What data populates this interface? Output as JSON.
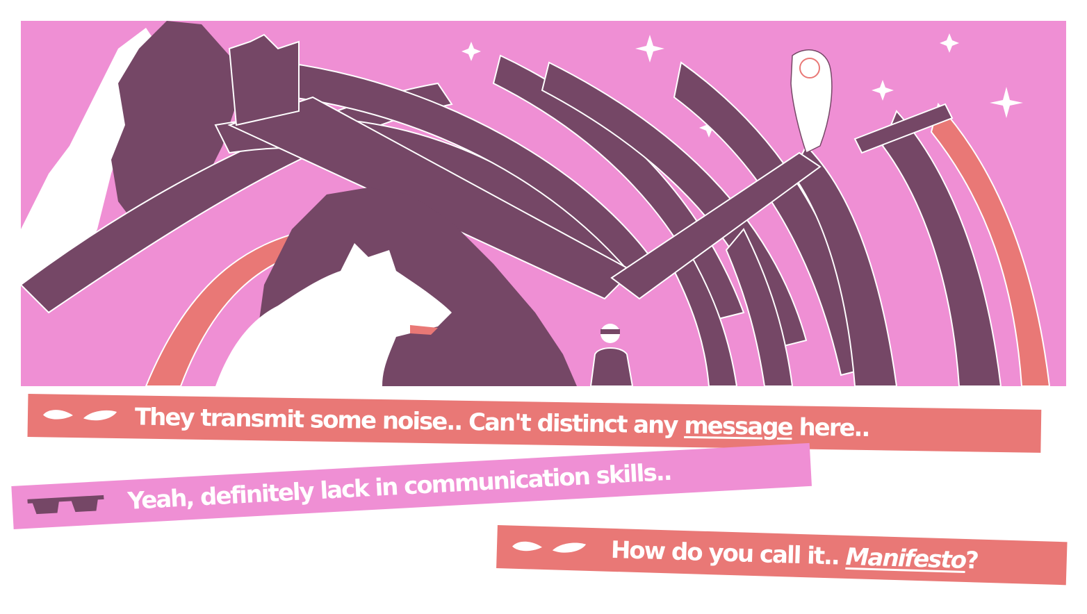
{
  "colors": {
    "sky": "#ef8fd4",
    "plum": "#754766",
    "coral": "#e97876",
    "white": "#ffffff"
  },
  "dialogue": [
    {
      "speaker_icon": "wolf-eyes-icon",
      "color": "#e97876",
      "before": "They transmit some noise.. Can't distinct any ",
      "emphasis": "message",
      "after": " here.."
    },
    {
      "speaker_icon": "sunglasses-icon",
      "color": "#ef8fd4",
      "before": "Yeah, definitely lack in communication skills..",
      "emphasis": "",
      "after": ""
    },
    {
      "speaker_icon": "wolf-eyes-icon",
      "color": "#e97876",
      "before": "How do you call it.. ",
      "emphasis": "Manifesto",
      "after": "?"
    }
  ]
}
